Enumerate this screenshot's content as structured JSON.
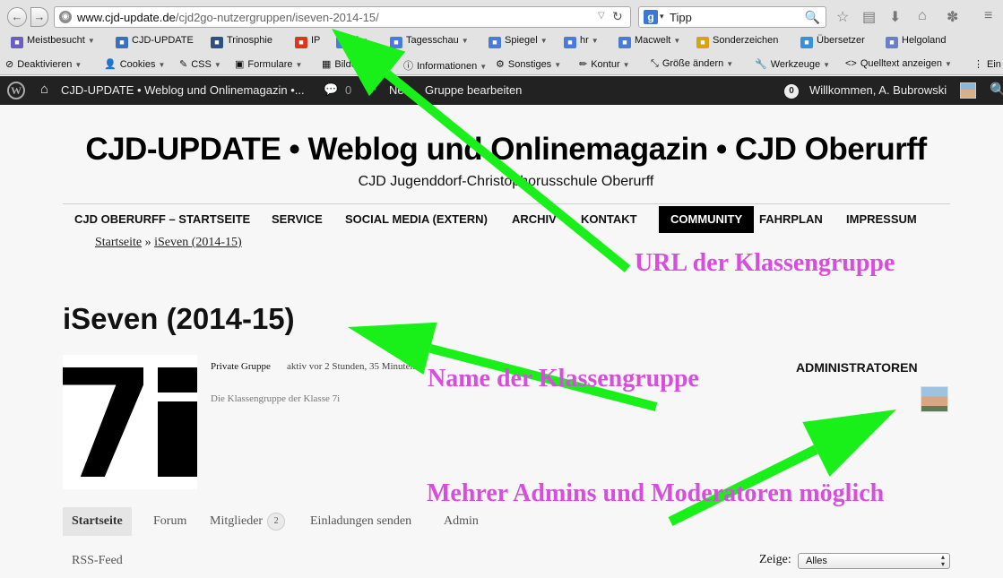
{
  "browser": {
    "url_host": "www.cjd-update.de",
    "url_path": "/cjd2go-nutzergruppen/iseven-2014-15/",
    "search_engine": "g",
    "search_value": "Tipp",
    "bookmarks": [
      {
        "label": "Meistbesucht",
        "icon": "folder-icon",
        "color": "#6a5fc1",
        "caret": true
      },
      {
        "label": "CJD-UPDATE",
        "icon": "cjd-favicon-icon",
        "color": "#3b6fb6",
        "caret": false
      },
      {
        "label": "Trinosphie",
        "icon": "t-favicon-icon",
        "color": "#2f4f7f",
        "caret": false
      },
      {
        "label": "IP",
        "icon": "gear-icon",
        "color": "#d43b1e",
        "caret": false
      },
      {
        "label": "T",
        "icon": "rss-folder-icon",
        "color": "#4a7bd8",
        "caret": true
      },
      {
        "label": "Tagesschau",
        "icon": "rss-folder-icon",
        "color": "#4a7bd8",
        "caret": true
      },
      {
        "label": "Spiegel",
        "icon": "rss-folder-icon",
        "color": "#4a7bd8",
        "caret": true
      },
      {
        "label": "hr",
        "icon": "rss-folder-icon",
        "color": "#4a7bd8",
        "caret": true
      },
      {
        "label": "Macwelt",
        "icon": "rss-folder-icon",
        "color": "#4a7bd8",
        "caret": true
      },
      {
        "label": "Sonderzeichen",
        "icon": "tag-icon",
        "color": "#d6a21c",
        "caret": false
      },
      {
        "label": "Übersetzer",
        "icon": "translate-icon",
        "color": "#3b8fd8",
        "caret": false
      },
      {
        "label": "Helgoland",
        "icon": "compass-icon",
        "color": "#6b7fc4",
        "caret": false
      }
    ],
    "webdev_toolbar": [
      {
        "label": "Deaktivieren",
        "icon": "ban-icon",
        "glyph": "⊘",
        "caret": true
      },
      {
        "label": "Cookies",
        "icon": "person-icon",
        "glyph": "👤",
        "caret": true
      },
      {
        "label": "CSS",
        "icon": "wand-icon",
        "glyph": "✎",
        "caret": true
      },
      {
        "label": "Formulare",
        "icon": "clipboard-icon",
        "glyph": "▣",
        "caret": true
      },
      {
        "label": "Bilder",
        "icon": "image-icon",
        "glyph": "▦",
        "caret": true
      },
      {
        "label": "Informationen",
        "icon": "info-icon",
        "glyph": "ⓘ",
        "caret": true
      },
      {
        "label": "Sonstiges",
        "icon": "cog-icon",
        "glyph": "⚙",
        "caret": true
      },
      {
        "label": "Kontur",
        "icon": "pencil-icon",
        "glyph": "✏",
        "caret": true
      },
      {
        "label": "Größe ändern",
        "icon": "resize-icon",
        "glyph": "⤡",
        "caret": true
      },
      {
        "label": "Werkzeuge",
        "icon": "wrench-icon",
        "glyph": "🔧",
        "caret": true
      },
      {
        "label": "Quelltext anzeigen",
        "icon": "code-icon",
        "glyph": "<>",
        "caret": true
      },
      {
        "label": "Ein",
        "icon": "options-icon",
        "glyph": "⋮",
        "caret": false
      }
    ]
  },
  "adminbar": {
    "site_name": "CJD-UPDATE • Weblog und Onlinemagazin •...",
    "comments_count": "0",
    "new_label": "Neu",
    "edit_group_label": "Gruppe bearbeiten",
    "notifications_count": "0",
    "greeting": "Willkommen, A. Bubrowski"
  },
  "site": {
    "title": "CJD-UPDATE • Weblog und Onlinemagazin • CJD Oberurff",
    "tagline": "CJD Jugenddorf-Christophorusschule Oberurff",
    "menu": [
      {
        "label": "CJD OBERURFF – STARTSEITE",
        "active": false
      },
      {
        "label": "SERVICE",
        "active": false
      },
      {
        "label": "SOCIAL MEDIA (EXTERN)",
        "active": false
      },
      {
        "label": "ARCHIV",
        "active": false
      },
      {
        "label": "KONTAKT",
        "active": false
      },
      {
        "label": "COMMUNITY",
        "active": true
      },
      {
        "label": "FAHRPLAN",
        "active": false
      },
      {
        "label": "IMPRESSUM",
        "active": false
      }
    ],
    "breadcrumb": {
      "home": "Startseite",
      "separator": "»",
      "current": "iSeven (2014-15)"
    }
  },
  "group": {
    "name": "iSeven (2014-15)",
    "type": "Private Gruppe",
    "activity": "aktiv vor 2 Stunden, 35 Minuten",
    "description": "Die Klassengruppe der Klasse 7i",
    "admins_heading": "ADMINISTRATOREN",
    "tabs": [
      {
        "label": "Startseite",
        "active": true
      },
      {
        "label": "Forum",
        "active": false
      },
      {
        "label": "Mitglieder",
        "active": false,
        "count": "2"
      },
      {
        "label": "Einladungen senden",
        "active": false
      },
      {
        "label": "Admin",
        "active": false
      }
    ],
    "rss_label": "RSS-Feed",
    "filter_label": "Zeige:",
    "filter_value": "Alles"
  },
  "annotations": {
    "color": "#d84ddd",
    "arrow_color": "#19f019",
    "url": "URL der Klassengruppe",
    "name": "Name der Klassengruppe",
    "admins": "Mehrer Admins und Moderatoren möglich"
  }
}
